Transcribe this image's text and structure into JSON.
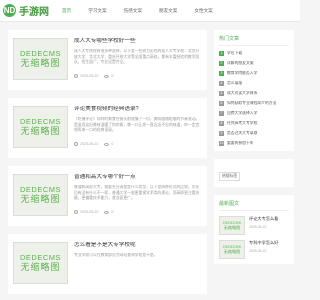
{
  "site": {
    "logo_icon": "ND",
    "logo_text": "手游网"
  },
  "nav": {
    "items": [
      {
        "label": "首页"
      },
      {
        "label": "学习文案"
      },
      {
        "label": "伤感文案"
      },
      {
        "label": "朋友文案"
      },
      {
        "label": "女性文案"
      }
    ]
  },
  "thumb": {
    "line1": "DEDECMS",
    "line2": "无缩略图"
  },
  "articles": [
    {
      "title": "成人大专哪些学校好一些",
      "desc": "成人大专院校有很多种选择，以下是一些较为出色的成人大专学校：北京开放大学、华北大学、重庆开放大学等全国重点高校，都有丰富经验的教学团队，招生面广，专业设置齐全。",
      "date": "2025-05-22",
      "views": "0"
    },
    {
      "title": "评论美食视频的经典语录?",
      "desc": "《吃播评论》同样的美食在镜头前放慢了一切，美味跟随咀嚼的节奏流动。是谁用这份美味温暖了你的胃，哪一口让你一直念念不忘的味道，你一定会想再来一口的经典语录。",
      "date": "2025-05-22",
      "views": "0"
    },
    {
      "title": "普通和高大专哪个好一点",
      "desc": "普通和高职大专，需要先分清楚是什么类型，以下是两种形式的比较。毕业后有没有什么不一样，普通大学一般更重视学术类的理论，而高职更注重技能，更偏重技术能力，就业面更广。",
      "date": "2025-05-22",
      "views": "0"
    },
    {
      "title": "怎么看是不是大专学校呢",
      "desc": "专业学校可以在教育部官方网站查询学校是不是。",
      "date": "",
      "views": ""
    }
  ],
  "sidebar": {
    "hot_title": "热门文章",
    "hot_items": [
      {
        "num": "1",
        "label": "学位下载"
      },
      {
        "num": "2",
        "label": "详解的朋友文案"
      },
      {
        "num": "3",
        "label": "教育学院能否入学"
      },
      {
        "num": "4",
        "label": "怎么填报"
      },
      {
        "num": "5",
        "label": "成大对读大学体系"
      },
      {
        "num": "6",
        "label": "如何获取专业课程简介的方法"
      },
      {
        "num": "7",
        "label": "自费大学选择入学"
      },
      {
        "num": "8",
        "label": "任何高考大专学校"
      },
      {
        "num": "9",
        "label": "是否过关大专录取"
      },
      {
        "num": "10",
        "label": "重要的参加十年"
      }
    ],
    "tags_title": "",
    "tag": "热搜标签",
    "recent_title": "最新图文",
    "recent_items": [
      {
        "title": "评论大专怎么看",
        "date": "2025-05-22"
      },
      {
        "title": "专科中学怎么好",
        "date": "2025-05-22"
      }
    ]
  }
}
